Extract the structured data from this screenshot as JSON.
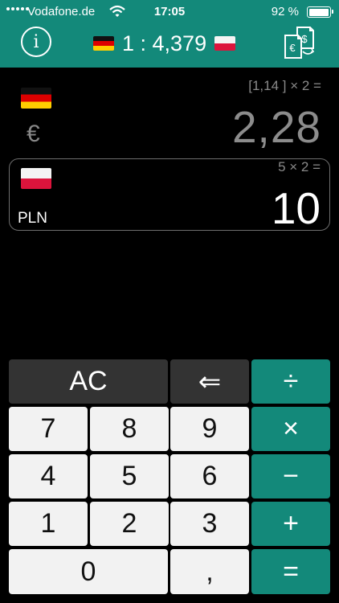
{
  "status_bar": {
    "carrier": "Vodafone.de",
    "time": "17:05",
    "battery_percent": "92 %",
    "battery_level": 0.92
  },
  "header": {
    "info_label": "i",
    "rate_text": "1 : 4,379",
    "from_flag": "germany-flag",
    "to_flag": "poland-flag",
    "convert_icon": "currency-exchange-icon"
  },
  "source": {
    "currency_symbol": "€",
    "expression": "[1,14 ] × 2 =",
    "value": "2,28"
  },
  "target": {
    "currency_code": "PLN",
    "expression": "5 × 2 =",
    "value": "10"
  },
  "keypad": {
    "ac": "AC",
    "backspace": "⇐",
    "divide": "÷",
    "multiply": "×",
    "minus": "−",
    "plus": "+",
    "equals": "=",
    "comma": ",",
    "k0": "0",
    "k1": "1",
    "k2": "2",
    "k3": "3",
    "k4": "4",
    "k5": "5",
    "k6": "6",
    "k7": "7",
    "k8": "8",
    "k9": "9"
  },
  "colors": {
    "accent": "#13897a",
    "background": "#000000",
    "key_light": "#f2f2f2",
    "key_dark": "#333333"
  }
}
